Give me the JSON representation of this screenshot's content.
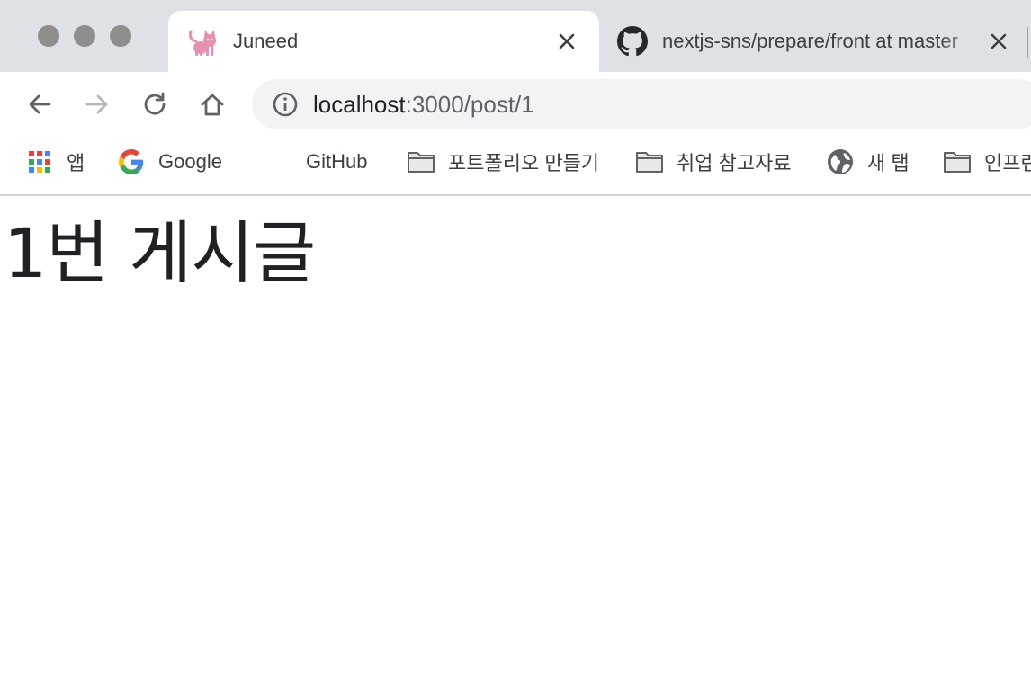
{
  "tabs": [
    {
      "title": "Juneed",
      "active": true,
      "favicon": "cat-icon"
    },
    {
      "title": "nextjs-sns/prepare/front at master",
      "active": false,
      "favicon": "github-icon"
    }
  ],
  "address_bar": {
    "host": "localhost",
    "path": ":3000/post/1"
  },
  "bookmarks": [
    {
      "label": "앱",
      "icon": "apps-grid-icon"
    },
    {
      "label": "Google",
      "icon": "google-icon"
    },
    {
      "label": "GitHub",
      "icon": ""
    },
    {
      "label": "포트폴리오 만들기",
      "icon": "folder-icon"
    },
    {
      "label": "취업 참고자료",
      "icon": "folder-icon"
    },
    {
      "label": "새 탭",
      "icon": "globe-icon"
    },
    {
      "label": "인프런",
      "icon": "folder-icon"
    }
  ],
  "page": {
    "heading": "1번 게시글"
  },
  "colors": {
    "tabstrip": "#dee1e6",
    "omnibox": "#f1f3f4",
    "traffic_light": "#8e8e8e",
    "cat_favicon": "#e78fb3"
  }
}
